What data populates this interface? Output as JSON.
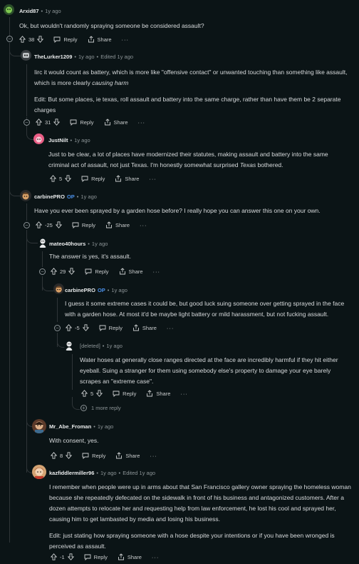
{
  "comments": {
    "arxid": {
      "user": "Arxid87",
      "time": "1y ago",
      "text": "Ok, but wouldn't randomly spraying someone be considered assault?",
      "score": "38",
      "reply": "Reply",
      "share": "Share",
      "more": "···"
    },
    "lurker": {
      "user": "TheLurker1209",
      "time": "1y ago",
      "edited": "Edited 1y ago",
      "p1_a": "Iirc it would count as battery, which is more like \"offensive contact\" or unwanted touching than something like assault, which is more clearly ",
      "p1_em": "causing harm",
      "p2": "Edit: But some places, ie texas, roll assault and battery into the same charge, rather than have them be 2 separate charges",
      "score": "31",
      "reply": "Reply",
      "share": "Share",
      "more": "···"
    },
    "justnilt": {
      "user": "JustNilt",
      "time": "1y ago",
      "text_a": "Just to be clear, a lot of places have modernized their statutes, making assault and battery into the same criminal act of assault, not just Texas. I'm honestly somewhat surprised ",
      "text_em": "Texas",
      "text_b": " bothered.",
      "score": "5",
      "reply": "Reply",
      "share": "Share",
      "more": "···"
    },
    "carbine1": {
      "user": "carbinePRO",
      "op": "OP",
      "time": "1y ago",
      "text": "Have you ever been sprayed by a garden hose before? I really hope you can answer this one on your own.",
      "score": "-25",
      "reply": "Reply",
      "share": "Share",
      "more": "···"
    },
    "mateo": {
      "user": "mateo40hours",
      "time": "1y ago",
      "text": "The answer is yes, it's assault.",
      "score": "29",
      "reply": "Reply",
      "share": "Share",
      "more": "···"
    },
    "carbine2": {
      "user": "carbinePRO",
      "op": "OP",
      "time": "1y ago",
      "text": "I guess it some extreme cases it could be, but good luck suing someone over getting sprayed in the face with a garden hose. At most it'd be maybe light battery or mild harassment, but not fucking assault.",
      "score": "-5",
      "reply": "Reply",
      "share": "Share",
      "more": "···"
    },
    "deleted": {
      "user": "[deleted]",
      "time": "1y ago",
      "text": "Water hoses at generally close ranges directed at the face are incredibly harmful if they hit either eyeball. Suing a stranger for them using somebody else's property to damage your eye barely scrapes an \"extreme case\".",
      "score": "5",
      "reply": "Reply",
      "share": "Share",
      "more": "···",
      "more_replies": "1 more reply"
    },
    "abe": {
      "user": "Mr_Abe_Froman",
      "time": "1y ago",
      "text": "With consent, yes.",
      "score": "8",
      "reply": "Reply",
      "share": "Share",
      "more": "···"
    },
    "kaz": {
      "user": "kazfiddlermiller96",
      "time": "1y ago",
      "edited": "Edited 1y ago",
      "p1": "I remember when people were up in arms about that San Francisco gallery owner spraying the homeless woman because she repeatedly defecated on the sidewalk in front of his business and antagonized customers. After a dozen attempts to relocate her and requesting help from law enforcement, he lost his cool and sprayed her, causing him to get lambasted by media and losing his business.",
      "p2": "Edit: just stating how spraying someone with a hose despite your intentions or if you have been wronged is perceived as assault.",
      "score": "-1",
      "reply": "Reply",
      "share": "Share",
      "more": "···"
    }
  },
  "colors": {
    "background": "#0b1416",
    "thread_line": "#2f3538",
    "op_badge": "#4a8fe7"
  }
}
